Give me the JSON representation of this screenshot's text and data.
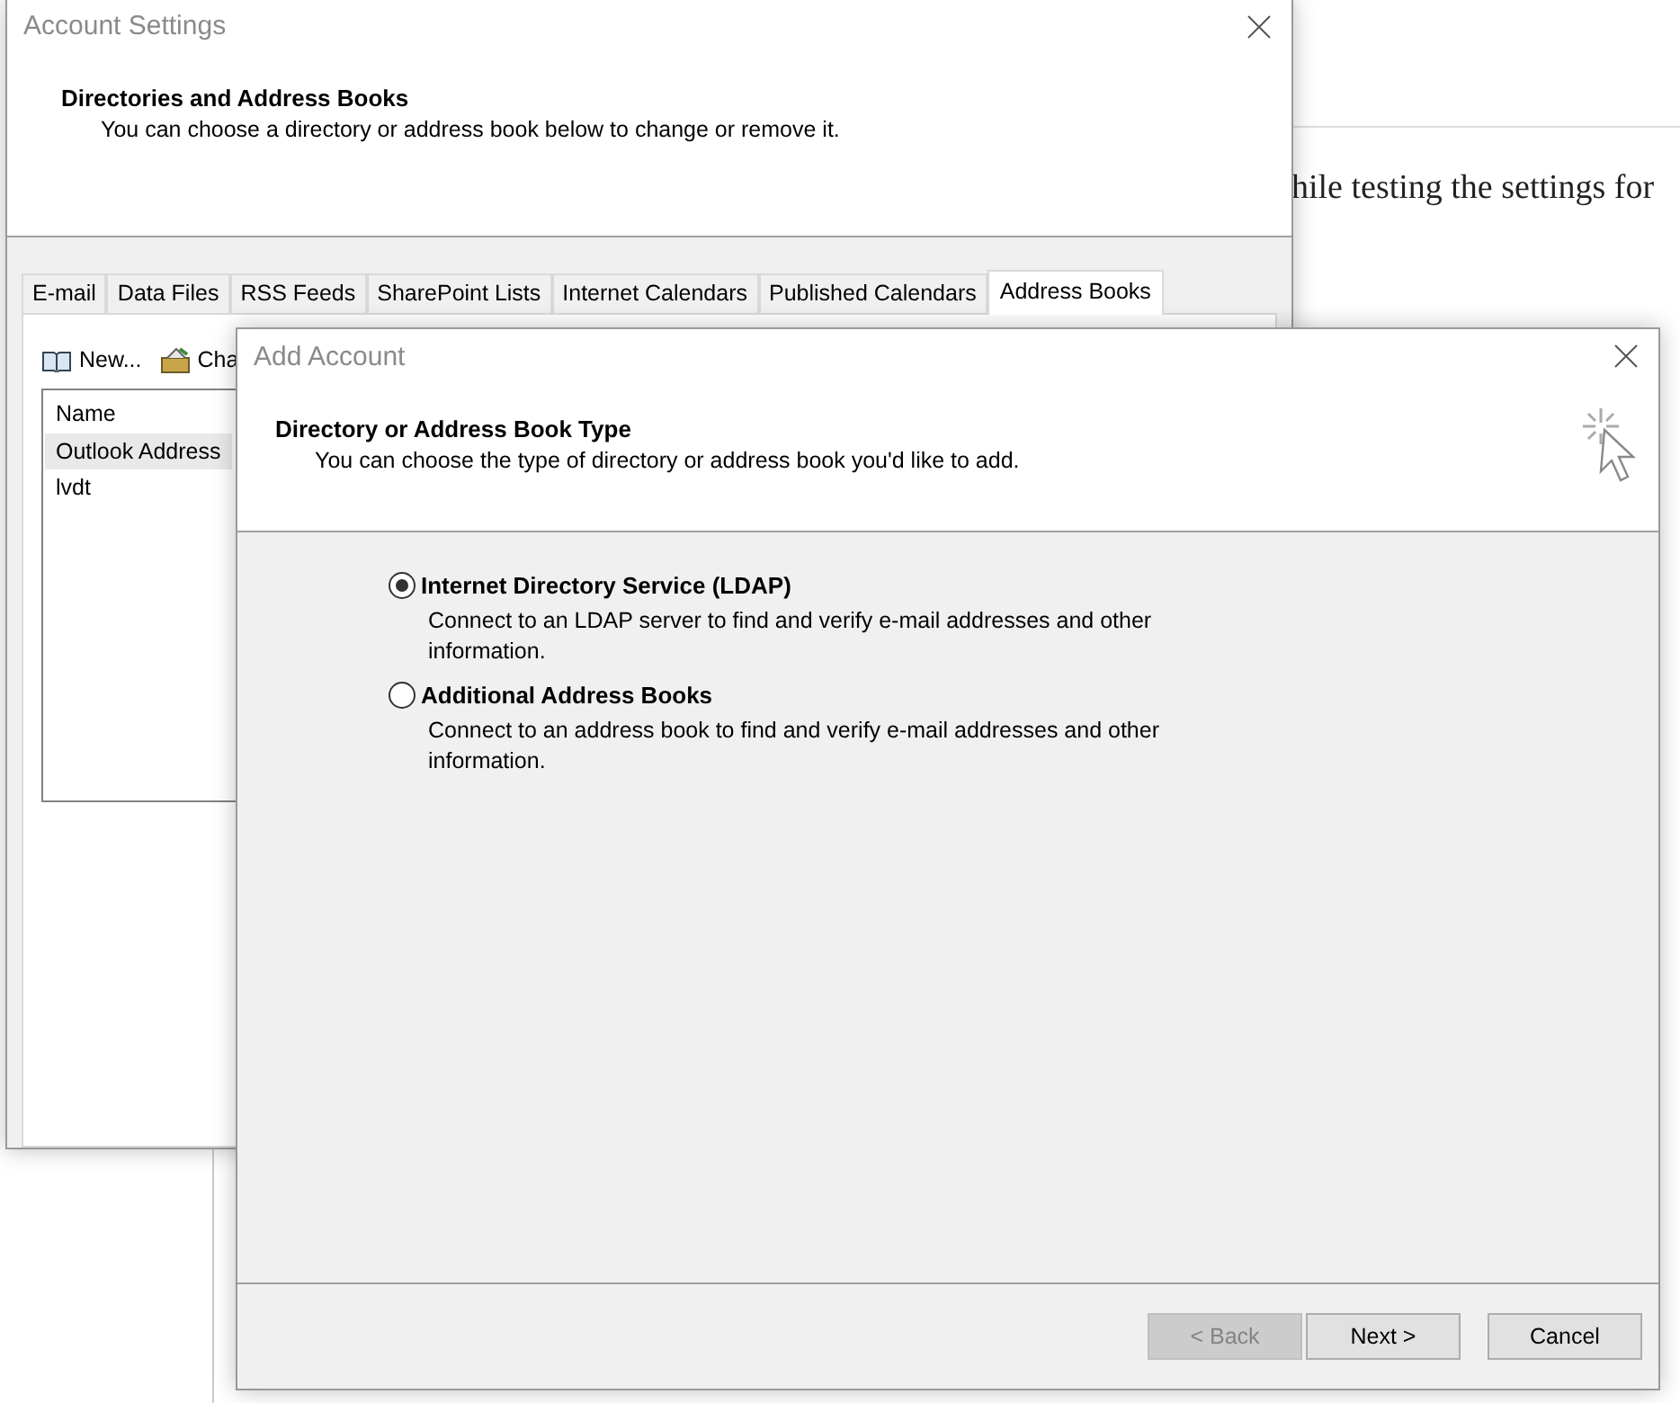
{
  "document": {
    "text": "hile testing the settings for"
  },
  "account_settings": {
    "title": "Account Settings",
    "heading": "Directories and Address Books",
    "description": "You can choose a directory or address book below to change or remove it.",
    "tabs": [
      {
        "label": "E-mail",
        "selected": false
      },
      {
        "label": "Data Files",
        "selected": false
      },
      {
        "label": "RSS Feeds",
        "selected": false
      },
      {
        "label": "SharePoint Lists",
        "selected": false
      },
      {
        "label": "Internet Calendars",
        "selected": false
      },
      {
        "label": "Published Calendars",
        "selected": false
      },
      {
        "label": "Address Books",
        "selected": true
      }
    ],
    "toolbar": [
      {
        "label": "New...",
        "kind": "new"
      },
      {
        "label": "Cha",
        "kind": "change"
      }
    ],
    "list": {
      "column": "Name",
      "rows": [
        {
          "name": "Outlook Address",
          "selected": true
        },
        {
          "name": "lvdt",
          "selected": false
        }
      ]
    }
  },
  "add_account": {
    "title": "Add Account",
    "heading": "Directory or Address Book Type",
    "description": "You can choose the type of directory or address book you'd like to add.",
    "options": [
      {
        "label": "Internet Directory Service (LDAP)",
        "description": "Connect to an LDAP server to find and verify e-mail addresses and other information.",
        "selected": true
      },
      {
        "label": "Additional Address Books",
        "description": "Connect to an address book to find and verify e-mail addresses and other information.",
        "selected": false
      }
    ],
    "buttons": [
      {
        "label": "< Back",
        "disabled": true
      },
      {
        "label": "Next >",
        "disabled": false
      },
      {
        "label": "Cancel",
        "disabled": false
      }
    ]
  }
}
